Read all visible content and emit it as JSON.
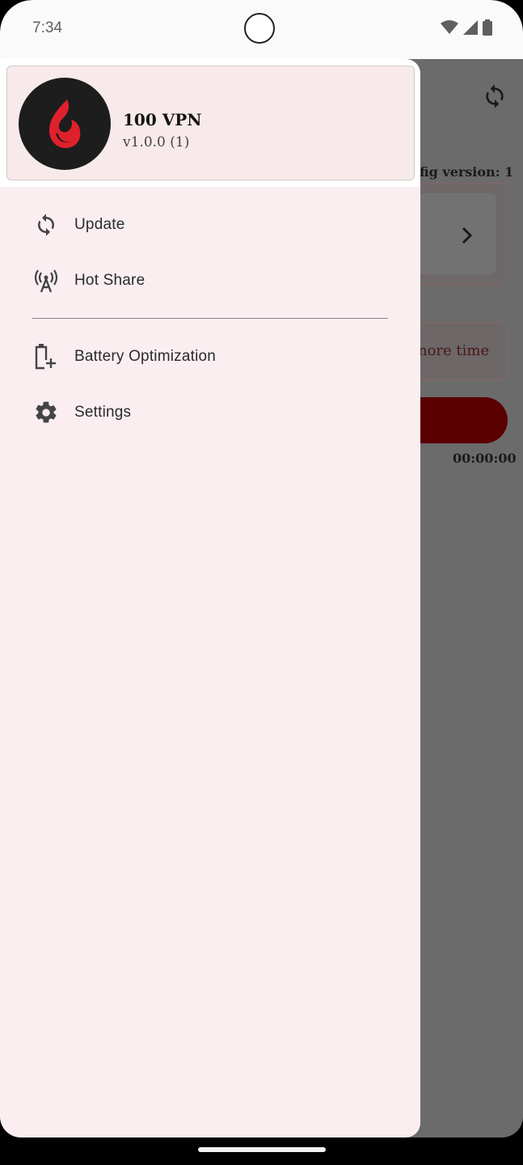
{
  "status_bar": {
    "time": "7:34"
  },
  "background_app": {
    "config_version": "fig version: 1",
    "more_time": "nore time",
    "timer": "00:00:00"
  },
  "drawer": {
    "app_name": "100 VPN",
    "app_version": "v1.0.0 (1)",
    "menu": [
      {
        "label": "Update",
        "icon": "refresh-icon"
      },
      {
        "label": "Hot Share",
        "icon": "antenna-icon"
      },
      {
        "label": "Battery Optimization",
        "icon": "battery-plus-icon"
      },
      {
        "label": "Settings",
        "icon": "gear-icon"
      }
    ]
  },
  "colors": {
    "drawer_bg": "#faeef1",
    "header_bg": "#f8eaea",
    "logo_flame": "#e0202c",
    "connect_button": "#5a0000"
  }
}
